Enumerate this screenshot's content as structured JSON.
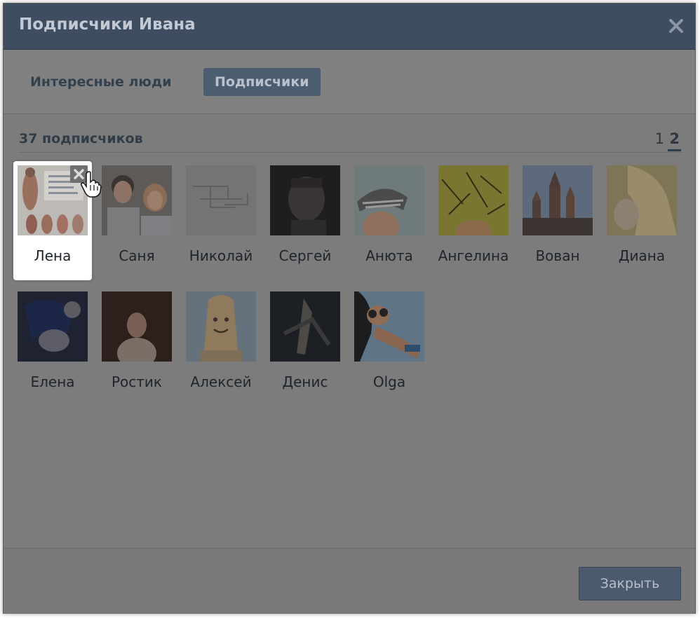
{
  "dialog": {
    "title": "Подписчики Ивана",
    "tabs": [
      {
        "label": "Интересные люди",
        "active": false
      },
      {
        "label": "Подписчики",
        "active": true
      }
    ],
    "count_text": "37 подписчиков",
    "pages": [
      "1",
      "2"
    ],
    "current_page": "2",
    "close_button_label": "Закрыть"
  },
  "followers": [
    {
      "name": "Лена"
    },
    {
      "name": "Саня"
    },
    {
      "name": "Николай"
    },
    {
      "name": "Сергей"
    },
    {
      "name": "Анюта"
    },
    {
      "name": "Ангелина"
    },
    {
      "name": "Вован"
    },
    {
      "name": "Диана"
    },
    {
      "name": "Елена"
    },
    {
      "name": "Ростик"
    },
    {
      "name": "Алексей"
    },
    {
      "name": "Денис"
    },
    {
      "name": "Olga"
    }
  ],
  "colors": {
    "titlebar": "#3e4d5f",
    "overlay": "#7c7c7c",
    "button": "#4b5a6d"
  }
}
